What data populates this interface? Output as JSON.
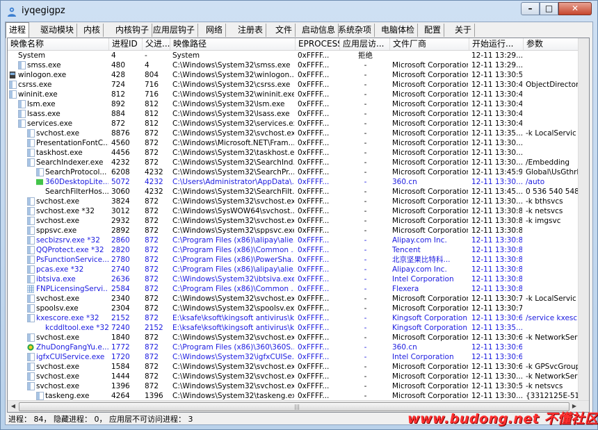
{
  "window": {
    "title": "iyqegigpz"
  },
  "tabs": [
    "进程",
    "驱动模块",
    "内核",
    "内核钩子",
    "应用层钩子",
    "网络",
    "注册表",
    "文件",
    "启动信息",
    "系统杂项",
    "电脑体检",
    "配置",
    "关于"
  ],
  "columns": [
    "映像名称",
    "进程ID",
    "父进...",
    "映像路径",
    "EPROCESS",
    "应用层访...",
    "文件厂商",
    "开始运行...",
    "参数"
  ],
  "rows": [
    {
      "name": "System",
      "pid": "4",
      "ppid": "-",
      "path": "System",
      "eprocess": "0xFFFF...",
      "access": "拒绝",
      "vendor": "",
      "start": "12-11 13:29...",
      "args": "",
      "indent": 0,
      "blue": false,
      "icon": "none"
    },
    {
      "name": "smss.exe",
      "pid": "480",
      "ppid": "4",
      "path": "C:\\Windows\\System32\\smss.exe",
      "eprocess": "0xFFFF...",
      "access": "-",
      "vendor": "Microsoft Corporation",
      "start": "12-11 13:29...",
      "args": "",
      "indent": 1,
      "blue": false,
      "icon": "plain"
    },
    {
      "name": "winlogon.exe",
      "pid": "428",
      "ppid": "804",
      "path": "C:\\Windows\\System32\\winlogon....",
      "eprocess": "0xFFFF...",
      "access": "-",
      "vendor": "Microsoft Corporation",
      "start": "12-11 13:30:5",
      "args": "",
      "indent": 0,
      "blue": false,
      "icon": "winlogon"
    },
    {
      "name": "csrss.exe",
      "pid": "724",
      "ppid": "716",
      "path": "C:\\Windows\\System32\\csrss.exe",
      "eprocess": "0xFFFF...",
      "access": "-",
      "vendor": "Microsoft Corporation",
      "start": "12-11 13:30:4",
      "args": "ObjectDirector",
      "indent": 0,
      "blue": false,
      "icon": "plain"
    },
    {
      "name": "wininit.exe",
      "pid": "812",
      "ppid": "716",
      "path": "C:\\Windows\\System32\\wininit.exe",
      "eprocess": "0xFFFF...",
      "access": "-",
      "vendor": "Microsoft Corporation",
      "start": "12-11 13:30:4",
      "args": "",
      "indent": 0,
      "blue": false,
      "icon": "plain"
    },
    {
      "name": "lsm.exe",
      "pid": "892",
      "ppid": "812",
      "path": "C:\\Windows\\System32\\lsm.exe",
      "eprocess": "0xFFFF...",
      "access": "-",
      "vendor": "Microsoft Corporation",
      "start": "12-11 13:30:4",
      "args": "",
      "indent": 1,
      "blue": false,
      "icon": "plain"
    },
    {
      "name": "lsass.exe",
      "pid": "884",
      "ppid": "812",
      "path": "C:\\Windows\\System32\\lsass.exe",
      "eprocess": "0xFFFF...",
      "access": "-",
      "vendor": "Microsoft Corporation",
      "start": "12-11 13:30:4",
      "args": "",
      "indent": 1,
      "blue": false,
      "icon": "plain"
    },
    {
      "name": "services.exe",
      "pid": "872",
      "ppid": "812",
      "path": "C:\\Windows\\System32\\services.exe",
      "eprocess": "0xFFFF...",
      "access": "-",
      "vendor": "Microsoft Corporation",
      "start": "12-11 13:30:4",
      "args": "",
      "indent": 1,
      "blue": false,
      "icon": "plain"
    },
    {
      "name": "svchost.exe",
      "pid": "8876",
      "ppid": "872",
      "path": "C:\\Windows\\System32\\svchost.exe",
      "eprocess": "0xFFFF...",
      "access": "-",
      "vendor": "Microsoft Corporation",
      "start": "12-11 13:35...",
      "args": "-k LocalServic",
      "indent": 2,
      "blue": false,
      "icon": "plain"
    },
    {
      "name": "PresentationFontC...",
      "pid": "4560",
      "ppid": "872",
      "path": "C:\\Windows\\Microsoft.NET\\Fram...",
      "eprocess": "0xFFFF...",
      "access": "-",
      "vendor": "Microsoft Corporation",
      "start": "12-11 13:30...",
      "args": "",
      "indent": 2,
      "blue": false,
      "icon": "plain"
    },
    {
      "name": "taskhost.exe",
      "pid": "4456",
      "ppid": "872",
      "path": "C:\\Windows\\System32\\taskhost.e...",
      "eprocess": "0xFFFF...",
      "access": "-",
      "vendor": "Microsoft Corporation",
      "start": "12-11 13:30...",
      "args": "",
      "indent": 2,
      "blue": false,
      "icon": "plain"
    },
    {
      "name": "SearchIndexer.exe",
      "pid": "4232",
      "ppid": "872",
      "path": "C:\\Windows\\System32\\SearchInd...",
      "eprocess": "0xFFFF...",
      "access": "-",
      "vendor": "Microsoft Corporation",
      "start": "12-11 13:30...",
      "args": "/Embedding",
      "indent": 2,
      "blue": false,
      "icon": "plain"
    },
    {
      "name": "SearchProtocol...",
      "pid": "6208",
      "ppid": "4232",
      "path": "C:\\Windows\\System32\\SearchPr...",
      "eprocess": "0xFFFF...",
      "access": "-",
      "vendor": "Microsoft Corporation",
      "start": "12-11 13:45:9",
      "args": "Global\\UsGthrF",
      "indent": 3,
      "blue": false,
      "icon": "plain"
    },
    {
      "name": "360DesktopLite...",
      "pid": "5072",
      "ppid": "4232",
      "path": "C:\\Users\\Administrator\\AppData\\...",
      "eprocess": "0xFFFF...",
      "access": "-",
      "vendor": "360.cn",
      "start": "12-11 13:30...",
      "args": "/auto",
      "indent": 3,
      "blue": true,
      "icon": "green"
    },
    {
      "name": "SearchFilterHos...",
      "pid": "3060",
      "ppid": "4232",
      "path": "C:\\Windows\\System32\\SearchFilt...",
      "eprocess": "0xFFFF...",
      "access": "-",
      "vendor": "Microsoft Corporation",
      "start": "12-11 13:45...",
      "args": "0 536 540 548",
      "indent": 3,
      "blue": false,
      "icon": "none"
    },
    {
      "name": "svchost.exe",
      "pid": "3824",
      "ppid": "872",
      "path": "C:\\Windows\\System32\\svchost.exe",
      "eprocess": "0xFFFF...",
      "access": "-",
      "vendor": "Microsoft Corporation",
      "start": "12-11 13:30...",
      "args": "-k bthsvcs",
      "indent": 2,
      "blue": false,
      "icon": "plain"
    },
    {
      "name": "svchost.exe *32",
      "pid": "3012",
      "ppid": "872",
      "path": "C:\\Windows\\SysWOW64\\svchost....",
      "eprocess": "0xFFFF...",
      "access": "-",
      "vendor": "Microsoft Corporation",
      "start": "12-11 13:30:8",
      "args": "-k netsvcs",
      "indent": 2,
      "blue": false,
      "icon": "plain"
    },
    {
      "name": "svchost.exe",
      "pid": "2932",
      "ppid": "872",
      "path": "C:\\Windows\\System32\\svchost.exe",
      "eprocess": "0xFFFF...",
      "access": "-",
      "vendor": "Microsoft Corporation",
      "start": "12-11 13:30:8",
      "args": "-k imgsvc",
      "indent": 2,
      "blue": false,
      "icon": "plain"
    },
    {
      "name": "sppsvc.exe",
      "pid": "2892",
      "ppid": "872",
      "path": "C:\\Windows\\System32\\sppsvc.exe",
      "eprocess": "0xFFFF...",
      "access": "-",
      "vendor": "Microsoft Corporation",
      "start": "12-11 13:30:8",
      "args": "",
      "indent": 2,
      "blue": false,
      "icon": "plain"
    },
    {
      "name": "secbizsrv.exe *32",
      "pid": "2860",
      "ppid": "872",
      "path": "C:\\Program Files (x86)\\alipay\\alie...",
      "eprocess": "0xFFFF...",
      "access": "-",
      "vendor": "Alipay.com Inc.",
      "start": "12-11 13:30:8",
      "args": "",
      "indent": 2,
      "blue": true,
      "icon": "plain"
    },
    {
      "name": "QQProtect.exe *32",
      "pid": "2820",
      "ppid": "872",
      "path": "C:\\Program Files (x86)\\Common ...",
      "eprocess": "0xFFFF...",
      "access": "-",
      "vendor": "Tencent",
      "start": "12-11 13:30:8",
      "args": "",
      "indent": 2,
      "blue": true,
      "icon": "plain"
    },
    {
      "name": "PsFunctionService...",
      "pid": "2780",
      "ppid": "872",
      "path": "C:\\Program Files (x86)\\PowerSha...",
      "eprocess": "0xFFFF...",
      "access": "-",
      "vendor": "北京坚果比特科...",
      "start": "12-11 13:30:8",
      "args": "",
      "indent": 2,
      "blue": true,
      "icon": "plain"
    },
    {
      "name": "pcas.exe *32",
      "pid": "2740",
      "ppid": "872",
      "path": "C:\\Program Files (x86)\\alipay\\alie...",
      "eprocess": "0xFFFF...",
      "access": "-",
      "vendor": "Alipay.com Inc.",
      "start": "12-11 13:30:8",
      "args": "",
      "indent": 2,
      "blue": true,
      "icon": "plain"
    },
    {
      "name": "ibtsiva.exe",
      "pid": "2636",
      "ppid": "872",
      "path": "C:\\Windows\\System32\\ibtsiva.exe",
      "eprocess": "0xFFFF...",
      "access": "-",
      "vendor": "Intel Corporation",
      "start": "12-11 13:30:8",
      "args": "",
      "indent": 2,
      "blue": true,
      "icon": "plain"
    },
    {
      "name": "FNPLicensingServi...",
      "pid": "2584",
      "ppid": "872",
      "path": "C:\\Program Files (x86)\\Common ...",
      "eprocess": "0xFFFF...",
      "access": "-",
      "vendor": "Flexera",
      "start": "12-11 13:30:8",
      "args": "",
      "indent": 2,
      "blue": true,
      "icon": "grid"
    },
    {
      "name": "svchost.exe",
      "pid": "2340",
      "ppid": "872",
      "path": "C:\\Windows\\System32\\svchost.exe",
      "eprocess": "0xFFFF...",
      "access": "-",
      "vendor": "Microsoft Corporation",
      "start": "12-11 13:30:7",
      "args": "-k LocalServic",
      "indent": 2,
      "blue": false,
      "icon": "plain"
    },
    {
      "name": "spoolsv.exe",
      "pid": "2304",
      "ppid": "872",
      "path": "C:\\Windows\\System32\\spoolsv.exe",
      "eprocess": "0xFFFF...",
      "access": "-",
      "vendor": "Microsoft Corporation",
      "start": "12-11 13:30:7",
      "args": "",
      "indent": 2,
      "blue": false,
      "icon": "plain"
    },
    {
      "name": "kxescore.exe *32",
      "pid": "2152",
      "ppid": "872",
      "path": "E:\\ksafe\\ksoft\\kingsoft antivirus\\k...",
      "eprocess": "0xFFFF...",
      "access": "-",
      "vendor": "Kingsoft Corporation",
      "start": "12-11 13:30:6",
      "args": "/service kxesc",
      "indent": 2,
      "blue": true,
      "icon": "plain"
    },
    {
      "name": "kcddltool.exe *32",
      "pid": "7240",
      "ppid": "2152",
      "path": "E:\\ksafe\\ksoft\\kingsoft antivirus\\k...",
      "eprocess": "0xFFFF...",
      "access": "-",
      "vendor": "Kingsoft Corporation",
      "start": "12-11 13:35...",
      "args": "",
      "indent": 3,
      "blue": true,
      "icon": "none"
    },
    {
      "name": "svchost.exe",
      "pid": "1840",
      "ppid": "872",
      "path": "C:\\Windows\\System32\\svchost.exe",
      "eprocess": "0xFFFF...",
      "access": "-",
      "vendor": "Microsoft Corporation",
      "start": "12-11 13:30:6",
      "args": "-k NetworkSer",
      "indent": 2,
      "blue": false,
      "icon": "plain"
    },
    {
      "name": "ZhuDongFangYu.e...",
      "pid": "1772",
      "ppid": "872",
      "path": "C:\\Program Files (x86)\\360\\360S...",
      "eprocess": "0xFFFF...",
      "access": "-",
      "vendor": "360.cn",
      "start": "12-11 13:30:6",
      "args": "",
      "indent": 2,
      "blue": true,
      "icon": "shield360"
    },
    {
      "name": "igfxCUIService.exe",
      "pid": "1720",
      "ppid": "872",
      "path": "C:\\Windows\\System32\\igfxCUISe...",
      "eprocess": "0xFFFF...",
      "access": "-",
      "vendor": "Intel Corporation",
      "start": "12-11 13:30:6",
      "args": "",
      "indent": 2,
      "blue": true,
      "icon": "plain"
    },
    {
      "name": "svchost.exe",
      "pid": "1584",
      "ppid": "872",
      "path": "C:\\Windows\\System32\\svchost.exe",
      "eprocess": "0xFFFF...",
      "access": "-",
      "vendor": "Microsoft Corporation",
      "start": "12-11 13:30:6",
      "args": "-k GPSvcGroup",
      "indent": 2,
      "blue": false,
      "icon": "plain"
    },
    {
      "name": "svchost.exe",
      "pid": "1444",
      "ppid": "872",
      "path": "C:\\Windows\\System32\\svchost.exe",
      "eprocess": "0xFFFF...",
      "access": "-",
      "vendor": "Microsoft Corporation",
      "start": "12-11 13:30...",
      "args": "-k NetworkSer",
      "indent": 2,
      "blue": false,
      "icon": "plain"
    },
    {
      "name": "svchost.exe",
      "pid": "1396",
      "ppid": "872",
      "path": "C:\\Windows\\System32\\svchost.exe",
      "eprocess": "0xFFFF...",
      "access": "-",
      "vendor": "Microsoft Corporation",
      "start": "12-11 13:30:5",
      "args": "-k netsvcs",
      "indent": 2,
      "blue": false,
      "icon": "plain"
    },
    {
      "name": "taskeng.exe",
      "pid": "4264",
      "ppid": "1396",
      "path": "C:\\Windows\\System32\\taskeng.exe",
      "eprocess": "0xFFFF...",
      "access": "-",
      "vendor": "Microsoft Corporation",
      "start": "12-11 13:30...",
      "args": "{3312125E-51",
      "indent": 3,
      "blue": false,
      "icon": "plain"
    }
  ],
  "status": {
    "text": "进程： 84， 隐藏进程： 0， 应用层不可访问进程： 3"
  },
  "watermark": {
    "text": "www.budong.net 不懂社区"
  },
  "colors": {
    "highlight_text": "#1a1adf",
    "watermark": "#ff3030"
  }
}
